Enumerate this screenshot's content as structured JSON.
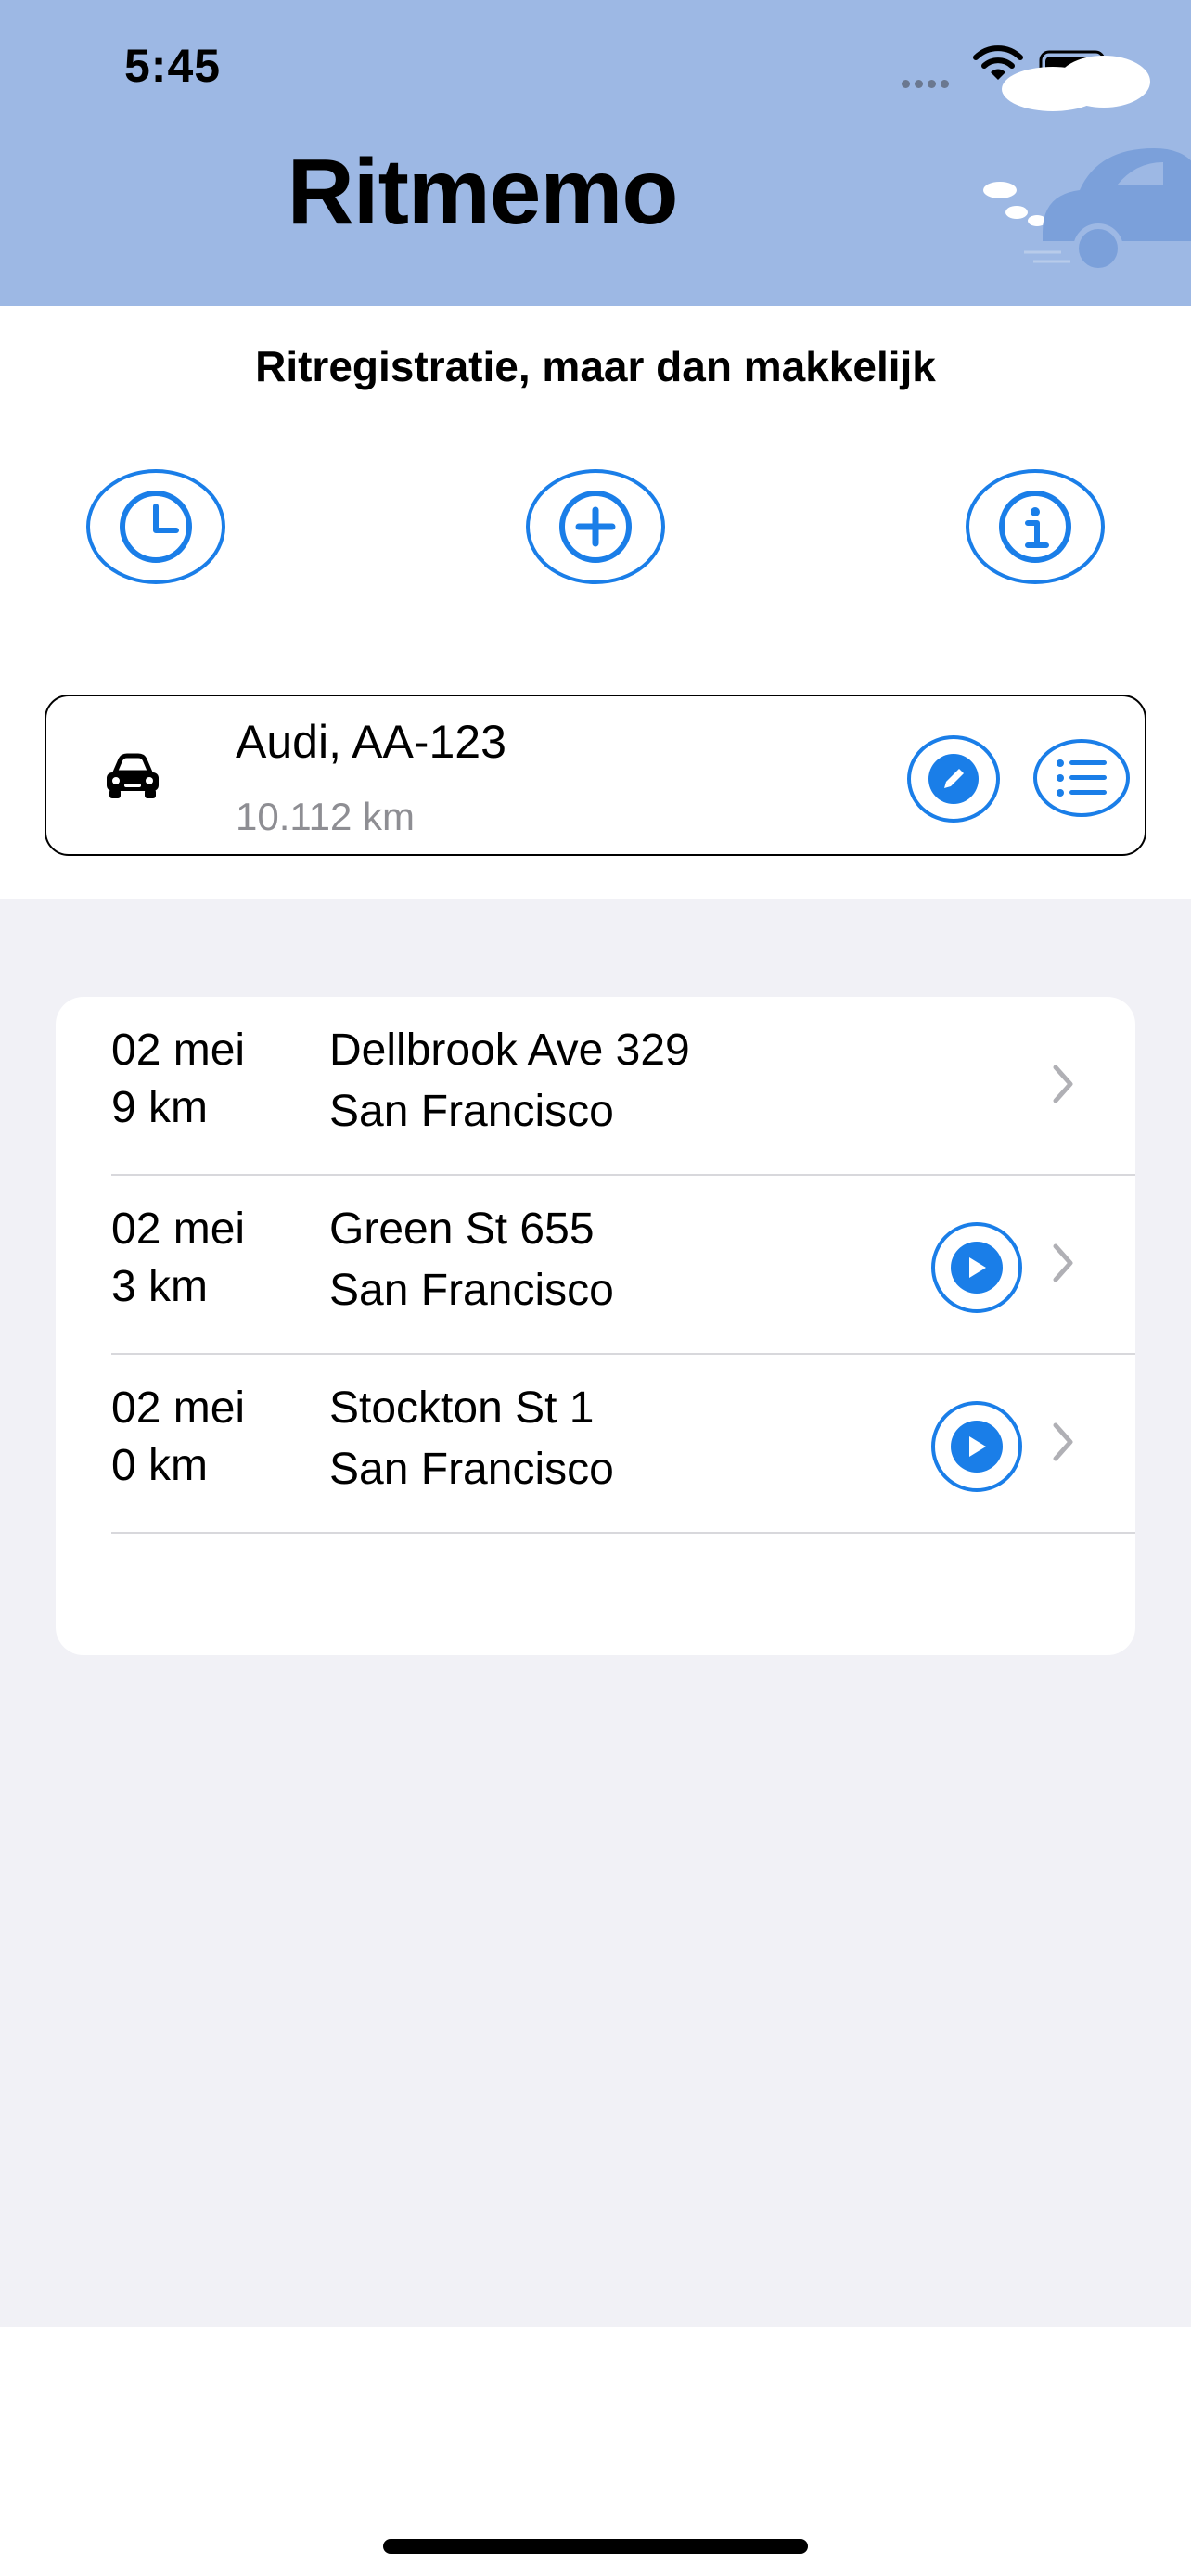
{
  "status_bar": {
    "time": "5:45"
  },
  "header": {
    "title": "Ritmemo"
  },
  "subtitle": "Ritregistratie, maar dan makkelijk",
  "actions": [
    {
      "name": "history",
      "icon": "clock-icon"
    },
    {
      "name": "add",
      "icon": "plus-circle-icon"
    },
    {
      "name": "info",
      "icon": "info-icon"
    }
  ],
  "vehicle": {
    "name": "Audi, AA-123",
    "odometer": "10.112 km",
    "icon": "car-icon"
  },
  "trips": [
    {
      "date": "02 mei",
      "distance": "9 km",
      "street": "Dellbrook Ave 329",
      "city": "San Francisco",
      "has_play": false
    },
    {
      "date": "02 mei",
      "distance": "3 km",
      "street": "Green St 655",
      "city": "San Francisco",
      "has_play": true
    },
    {
      "date": "02 mei",
      "distance": "0 km",
      "street": "Stockton St 1",
      "city": "San Francisco",
      "has_play": true
    }
  ],
  "colors": {
    "accent": "#1a7ee8",
    "header_bg": "#9db8e4",
    "list_bg": "#f1f1f6",
    "secondary_text": "#8e8e93"
  }
}
